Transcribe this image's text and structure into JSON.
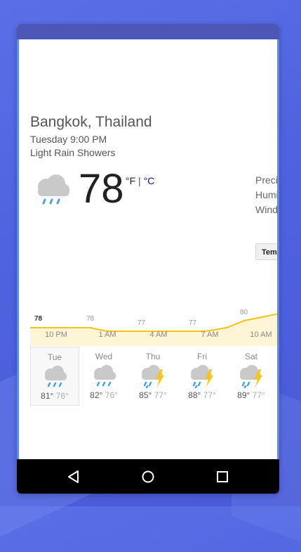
{
  "location": {
    "city": "Bangkok, Thailand",
    "datetime": "Tuesday 9:00 PM",
    "condition": "Light Rain Showers"
  },
  "current": {
    "temp": "78",
    "unit_f": "°F",
    "unit_sep": " | ",
    "unit_c": "°C",
    "icon": "rain-cloud-icon"
  },
  "details": {
    "precip": "Preci",
    "humidity": "Humi",
    "wind": "Wind"
  },
  "tabs": {
    "temperature": "Temp"
  },
  "hourly": {
    "temps": [
      "78",
      "78",
      "77",
      "77",
      "80"
    ],
    "times": [
      "10 PM",
      "1 AM",
      "4 AM",
      "7 AM",
      "10 AM"
    ]
  },
  "forecast": [
    {
      "day": "Tue",
      "hi": "81°",
      "lo": "76°",
      "icon": "rain-cloud-icon"
    },
    {
      "day": "Wed",
      "hi": "82°",
      "lo": "76°",
      "icon": "rain-cloud-icon"
    },
    {
      "day": "Thu",
      "hi": "85°",
      "lo": "77°",
      "icon": "thunderstorm-icon"
    },
    {
      "day": "Fri",
      "hi": "88°",
      "lo": "77°",
      "icon": "thunderstorm-icon"
    },
    {
      "day": "Sat",
      "hi": "89°",
      "lo": "77°",
      "icon": "thunderstorm-icon"
    }
  ],
  "colors": {
    "chart_line": "#f0c419",
    "chart_fill": "#fdf5d6",
    "rain_drop": "#48a3d8",
    "bolt": "#f5c518",
    "cloud": "#c9c9c9",
    "celsius_link": "#1a0dab"
  }
}
